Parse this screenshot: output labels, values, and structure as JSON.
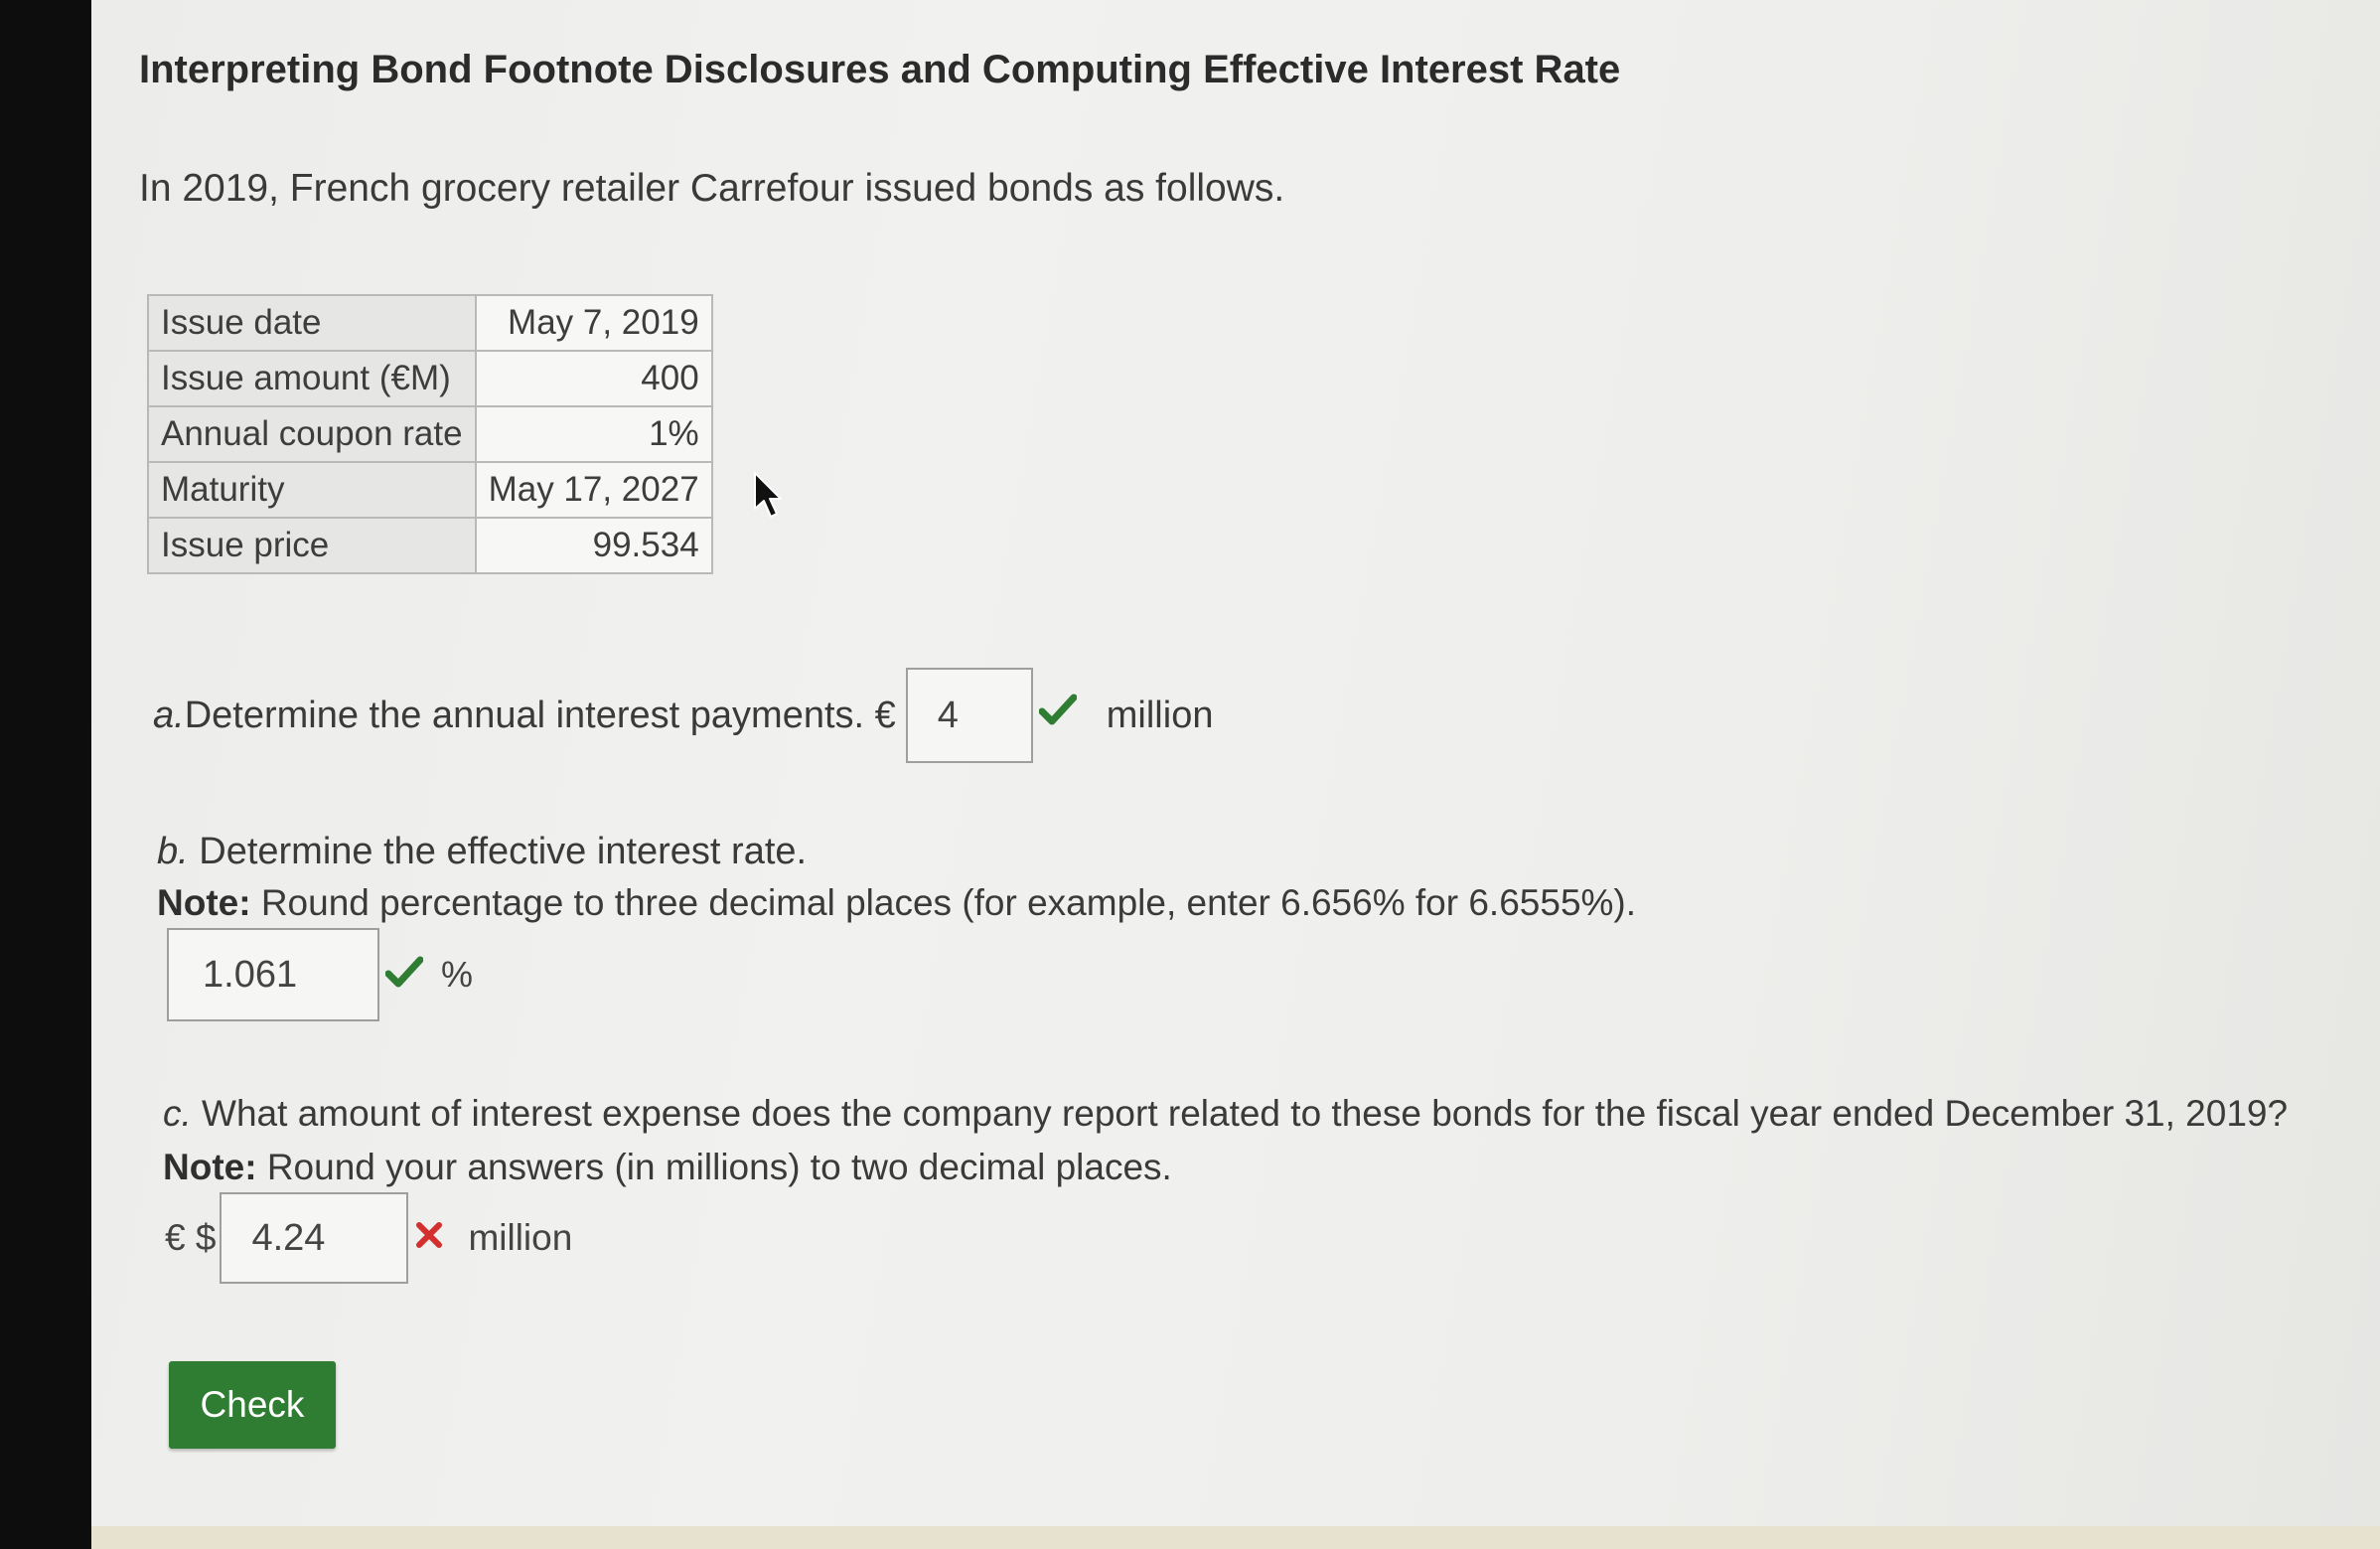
{
  "header": {
    "title": "Interpreting Bond Footnote Disclosures and Computing Effective Interest Rate",
    "intro": "In 2019, French grocery retailer Carrefour issued bonds as follows."
  },
  "bond_table": {
    "rows": [
      {
        "label": "Issue date",
        "value": "May 7, 2019"
      },
      {
        "label": "Issue amount (€M)",
        "value": "400"
      },
      {
        "label": "Annual coupon rate",
        "value": "1%"
      },
      {
        "label": "Maturity",
        "value": "May 17, 2027"
      },
      {
        "label": "Issue price",
        "value": "99.534"
      }
    ]
  },
  "question_a": {
    "letter": "a.",
    "text": " Determine the annual interest payments. €",
    "answer": "4",
    "unit": "million",
    "status": "correct"
  },
  "question_b": {
    "letter": "b.",
    "text": " Determine the effective interest rate.",
    "note_label": "Note:",
    "note_text": " Round percentage to three decimal places (for example, enter 6.656% for 6.6555%).",
    "answer": "1.061",
    "unit": "%",
    "status": "correct"
  },
  "question_c": {
    "letter": "c.",
    "text": " What amount of interest expense does the company report related to these bonds for the fiscal year ended December 31, 2019?",
    "note_label": "Note:",
    "note_text": " Round your answers (in millions) to two decimal places.",
    "prefix": "€ $",
    "answer": "4.24",
    "unit": "million",
    "status": "incorrect"
  },
  "actions": {
    "check_label": "Check"
  },
  "colors": {
    "correct": "#2e7d32",
    "incorrect": "#d32f2f",
    "button": "#2f7d32"
  },
  "icons": {
    "correct": "check-mark-icon",
    "incorrect": "x-mark-icon",
    "cursor": "mouse-cursor-icon"
  }
}
